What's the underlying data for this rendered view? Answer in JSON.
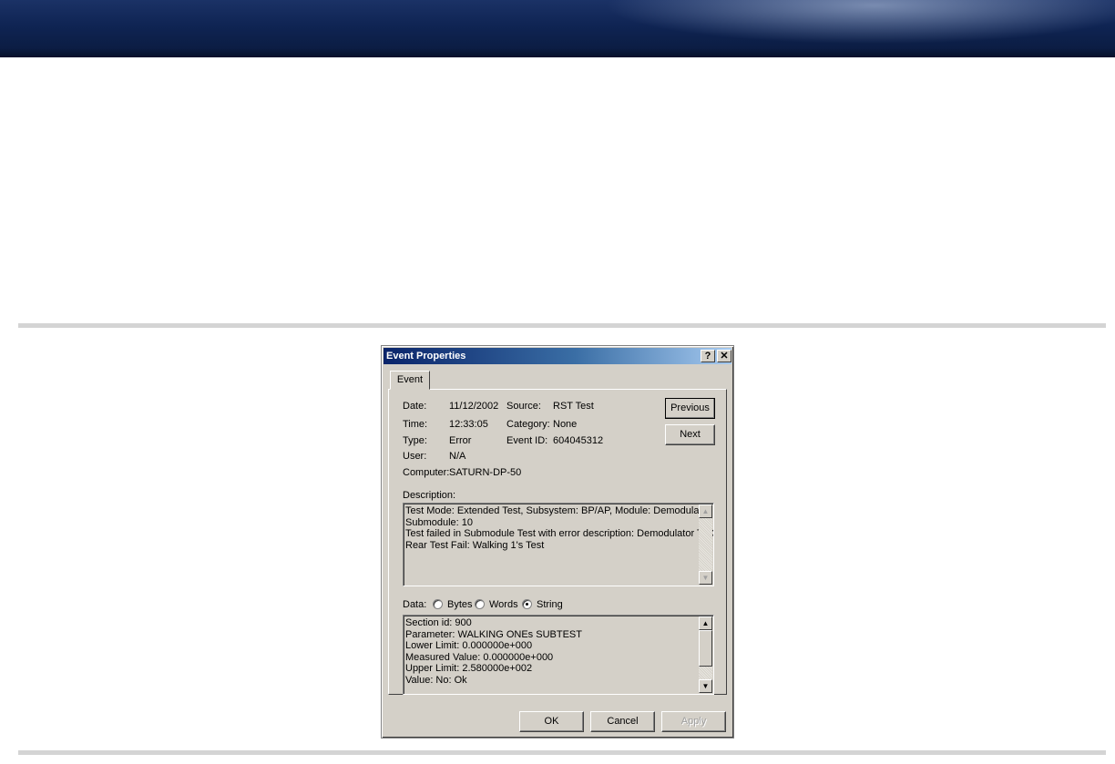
{
  "dialog": {
    "title": "Event Properties",
    "help_glyph": "?",
    "close_glyph": "✕",
    "tab_label": "Event",
    "fields": {
      "date_label": "Date:",
      "date_value": "11/12/2002",
      "source_label": "Source:",
      "source_value": "RST Test",
      "time_label": "Time:",
      "time_value": "12:33:05",
      "category_label": "Category:",
      "category_value": "None",
      "type_label": "Type:",
      "type_value": "Error",
      "event_id_label": "Event ID:",
      "event_id_value": "604045312",
      "user_label": "User:",
      "user_value": "N/A",
      "computer_label": "Computer:",
      "computer_value": "SATURN-DP-50"
    },
    "previous_label": "Previous",
    "next_label": "Next",
    "description_label": "Description:",
    "description_lines": [
      "Test Mode: Extended Test, Subsystem: BP/AP, Module: Demodulator,",
      "Submodule: 10",
      "Test failed in Submodule Test  with error description: Demodulator TGC",
      "Rear Test Fail: Walking 1's Test"
    ],
    "data_label": "Data:",
    "data_options": [
      {
        "label": "Bytes",
        "selected": false
      },
      {
        "label": "Words",
        "selected": false
      },
      {
        "label": "String",
        "selected": true
      }
    ],
    "data_lines": [
      "Section id: 900",
      "Parameter: WALKING ONEs SUBTEST",
      "Lower Limit: 0.000000e+000",
      "Measured Value: 0.000000e+000",
      "Upper Limit: 2.580000e+002",
      "Value: No: Ok"
    ],
    "ok_label": "OK",
    "cancel_label": "Cancel",
    "apply_label": "Apply"
  },
  "colors": {
    "banner": "#0f2453",
    "dialog_face": "#d4d0c8",
    "titlebar_start": "#0a246a",
    "titlebar_end": "#a6caf0",
    "rule": "#d4d4d4"
  }
}
